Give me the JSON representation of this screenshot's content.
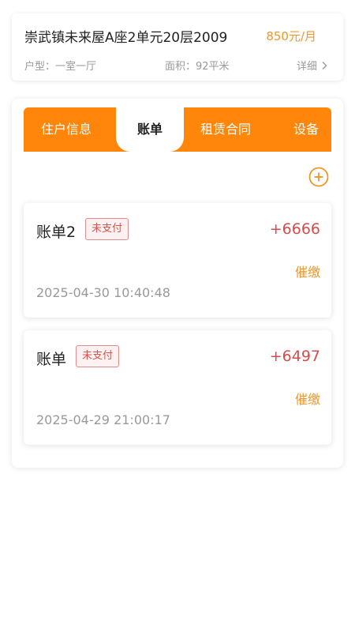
{
  "property": {
    "title": "崇武镇未来屋A座2单元20层2009",
    "price": "850元/月",
    "type_text": "户型：一室一厅",
    "area_text": "面积：92平米",
    "detail_label": "详细",
    "chevron_icon": "chevron-right-icon"
  },
  "tabs": [
    {
      "label": "住户信息",
      "active": false
    },
    {
      "label": "账单",
      "active": true
    },
    {
      "label": "租赁合同",
      "active": false
    },
    {
      "label": "设备",
      "active": false
    }
  ],
  "add_icon": "plus-circle-icon",
  "bills": [
    {
      "name": "账单2",
      "status": "未支付",
      "amount": "+6666",
      "action": "催缴",
      "time": "2025-04-30 10:40:48"
    },
    {
      "name": "账单",
      "status": "未支付",
      "amount": "+6497",
      "action": "催缴",
      "time": "2025-04-29 21:00:17"
    }
  ],
  "colors": {
    "accent": "#ff850b",
    "price": "#f0962a",
    "amount": "#d94a4a",
    "badge_text": "#d9534f"
  }
}
